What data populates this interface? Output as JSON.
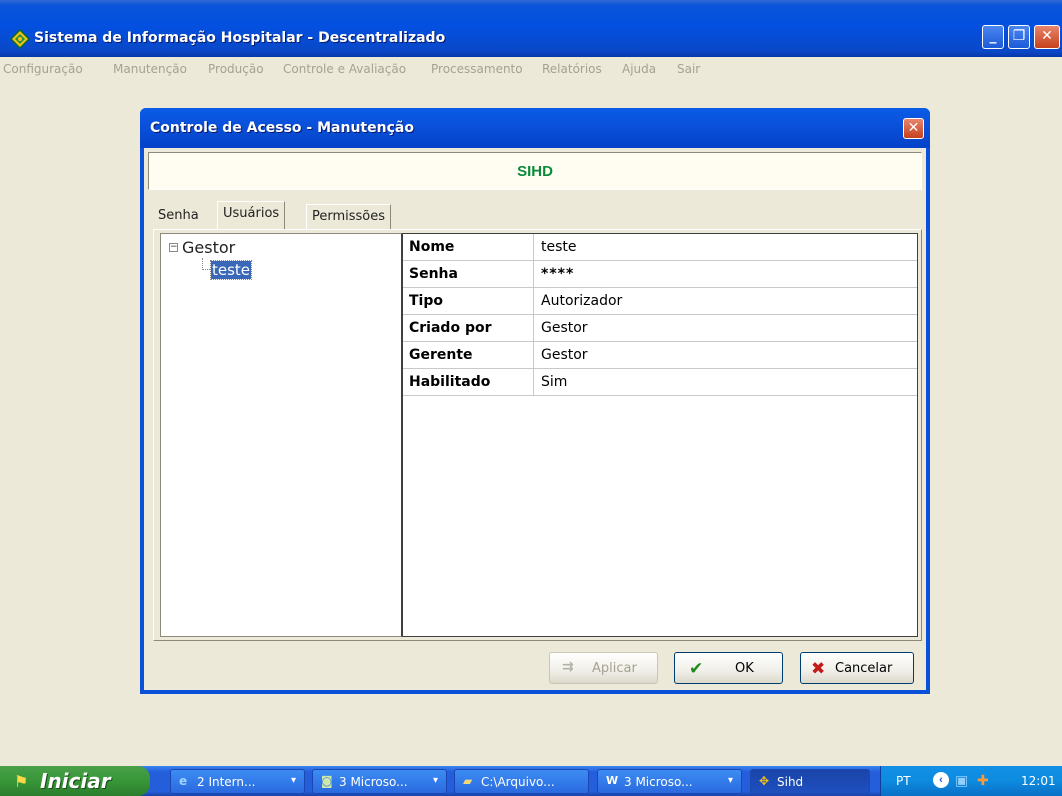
{
  "window": {
    "title": "Sistema de Informação Hospitalar - Descentralizado",
    "min_icon": "_",
    "max_icon": "❐",
    "close_icon": "✕"
  },
  "menu": [
    "Configuração",
    "Manutenção",
    "Produção",
    "Controle e Avaliação",
    "Processamento",
    "Relatórios",
    "Ajuda",
    "Sair"
  ],
  "dialog": {
    "title": "Controle de Acesso - Manutenção",
    "close_icon": "✕",
    "banner": "SIHD",
    "tabs": [
      "Senha",
      "Usuários",
      "Permissões"
    ],
    "active_tab": "Usuários",
    "tree": {
      "expander": "−",
      "root": "Gestor",
      "child": "teste"
    },
    "properties": [
      {
        "key": "Nome",
        "value": "teste"
      },
      {
        "key": "Senha",
        "value": "****"
      },
      {
        "key": "Tipo",
        "value": "Autorizador"
      },
      {
        "key": "Criado por",
        "value": "Gestor"
      },
      {
        "key": "Gerente",
        "value": "Gestor"
      },
      {
        "key": "Habilitado",
        "value": "Sim"
      }
    ],
    "buttons": {
      "apply": "Aplicar",
      "ok": "OK",
      "cancel": "Cancelar",
      "apply_icon": "⇉",
      "ok_icon": "✔",
      "cancel_icon": "✖"
    }
  },
  "taskbar": {
    "start": "Iniciar",
    "tasks": [
      {
        "label": "2 Intern...",
        "icon": "e",
        "has_arrow": true
      },
      {
        "label": "3 Microso...",
        "icon": "◙",
        "has_arrow": true
      },
      {
        "label": "C:\\Arquivo...",
        "icon": "▰",
        "has_arrow": false
      },
      {
        "label": "3 Microso...",
        "icon": "W",
        "has_arrow": true
      },
      {
        "label": "Sihd",
        "icon": "✥",
        "has_arrow": false
      }
    ],
    "arrow": "▾",
    "tray": {
      "lang": "PT",
      "back": "‹",
      "clock": "12:01"
    }
  },
  "colors": {
    "titlebar": "#0350e0",
    "banner_text": "#0c8a3c",
    "selection": "#3a68b8",
    "taskbar": "#245edb",
    "start": "#379737"
  }
}
